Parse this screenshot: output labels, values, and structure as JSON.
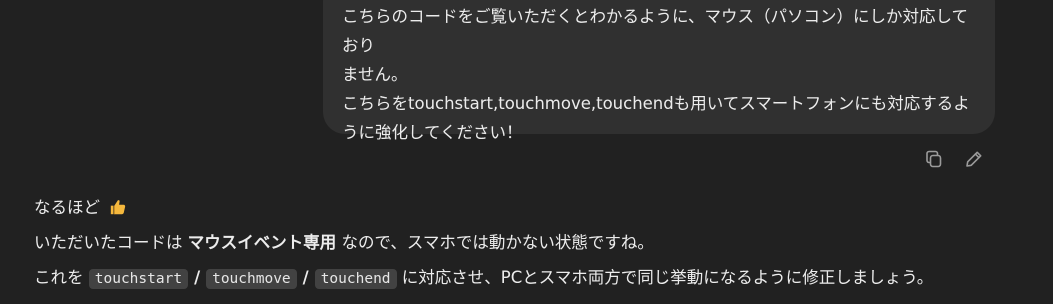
{
  "user_message": {
    "paragraphs": [
      "こちらのコードをご覧いただくとわかるように、マウス（パソコン）にしか対応しておりません。",
      "こちらをtouchstart,touchmove,touchendも用いてスマートフォンにも対応するように強化してください！"
    ],
    "lines": [
      "こちらのコードをご覧いただくとわかるように、マウス（パソコン）にしか対応しており",
      "ません。",
      "こちらをtouchstart,touchmove,touchendも用いてスマートフォンにも対応するよ",
      "うに強化してください！"
    ]
  },
  "message_actions": {
    "copy_icon": "copy-icon",
    "edit_icon": "pencil-icon"
  },
  "assistant_message": {
    "line1": "なるほど",
    "line1_emoji": "thumbs-up",
    "line2_pre": "いただいたコードは ",
    "line2_bold": "マウスイベント専用",
    "line2_post": " なので、スマホでは動かない状態ですね。",
    "line3_pre": "これを ",
    "code1": "touchstart",
    "sep1": "/",
    "code2": "touchmove",
    "sep2": "/",
    "code3": "touchend",
    "line3_post": " に対応させ、PCとスマホ両方で同じ挙動になるように修正しましょう。"
  },
  "colors": {
    "background": "#212121",
    "bubble": "#303030",
    "text": "#ececec",
    "icon": "#9b9b9b",
    "emoji": "#f5b83d",
    "code_bg": "#424242"
  }
}
